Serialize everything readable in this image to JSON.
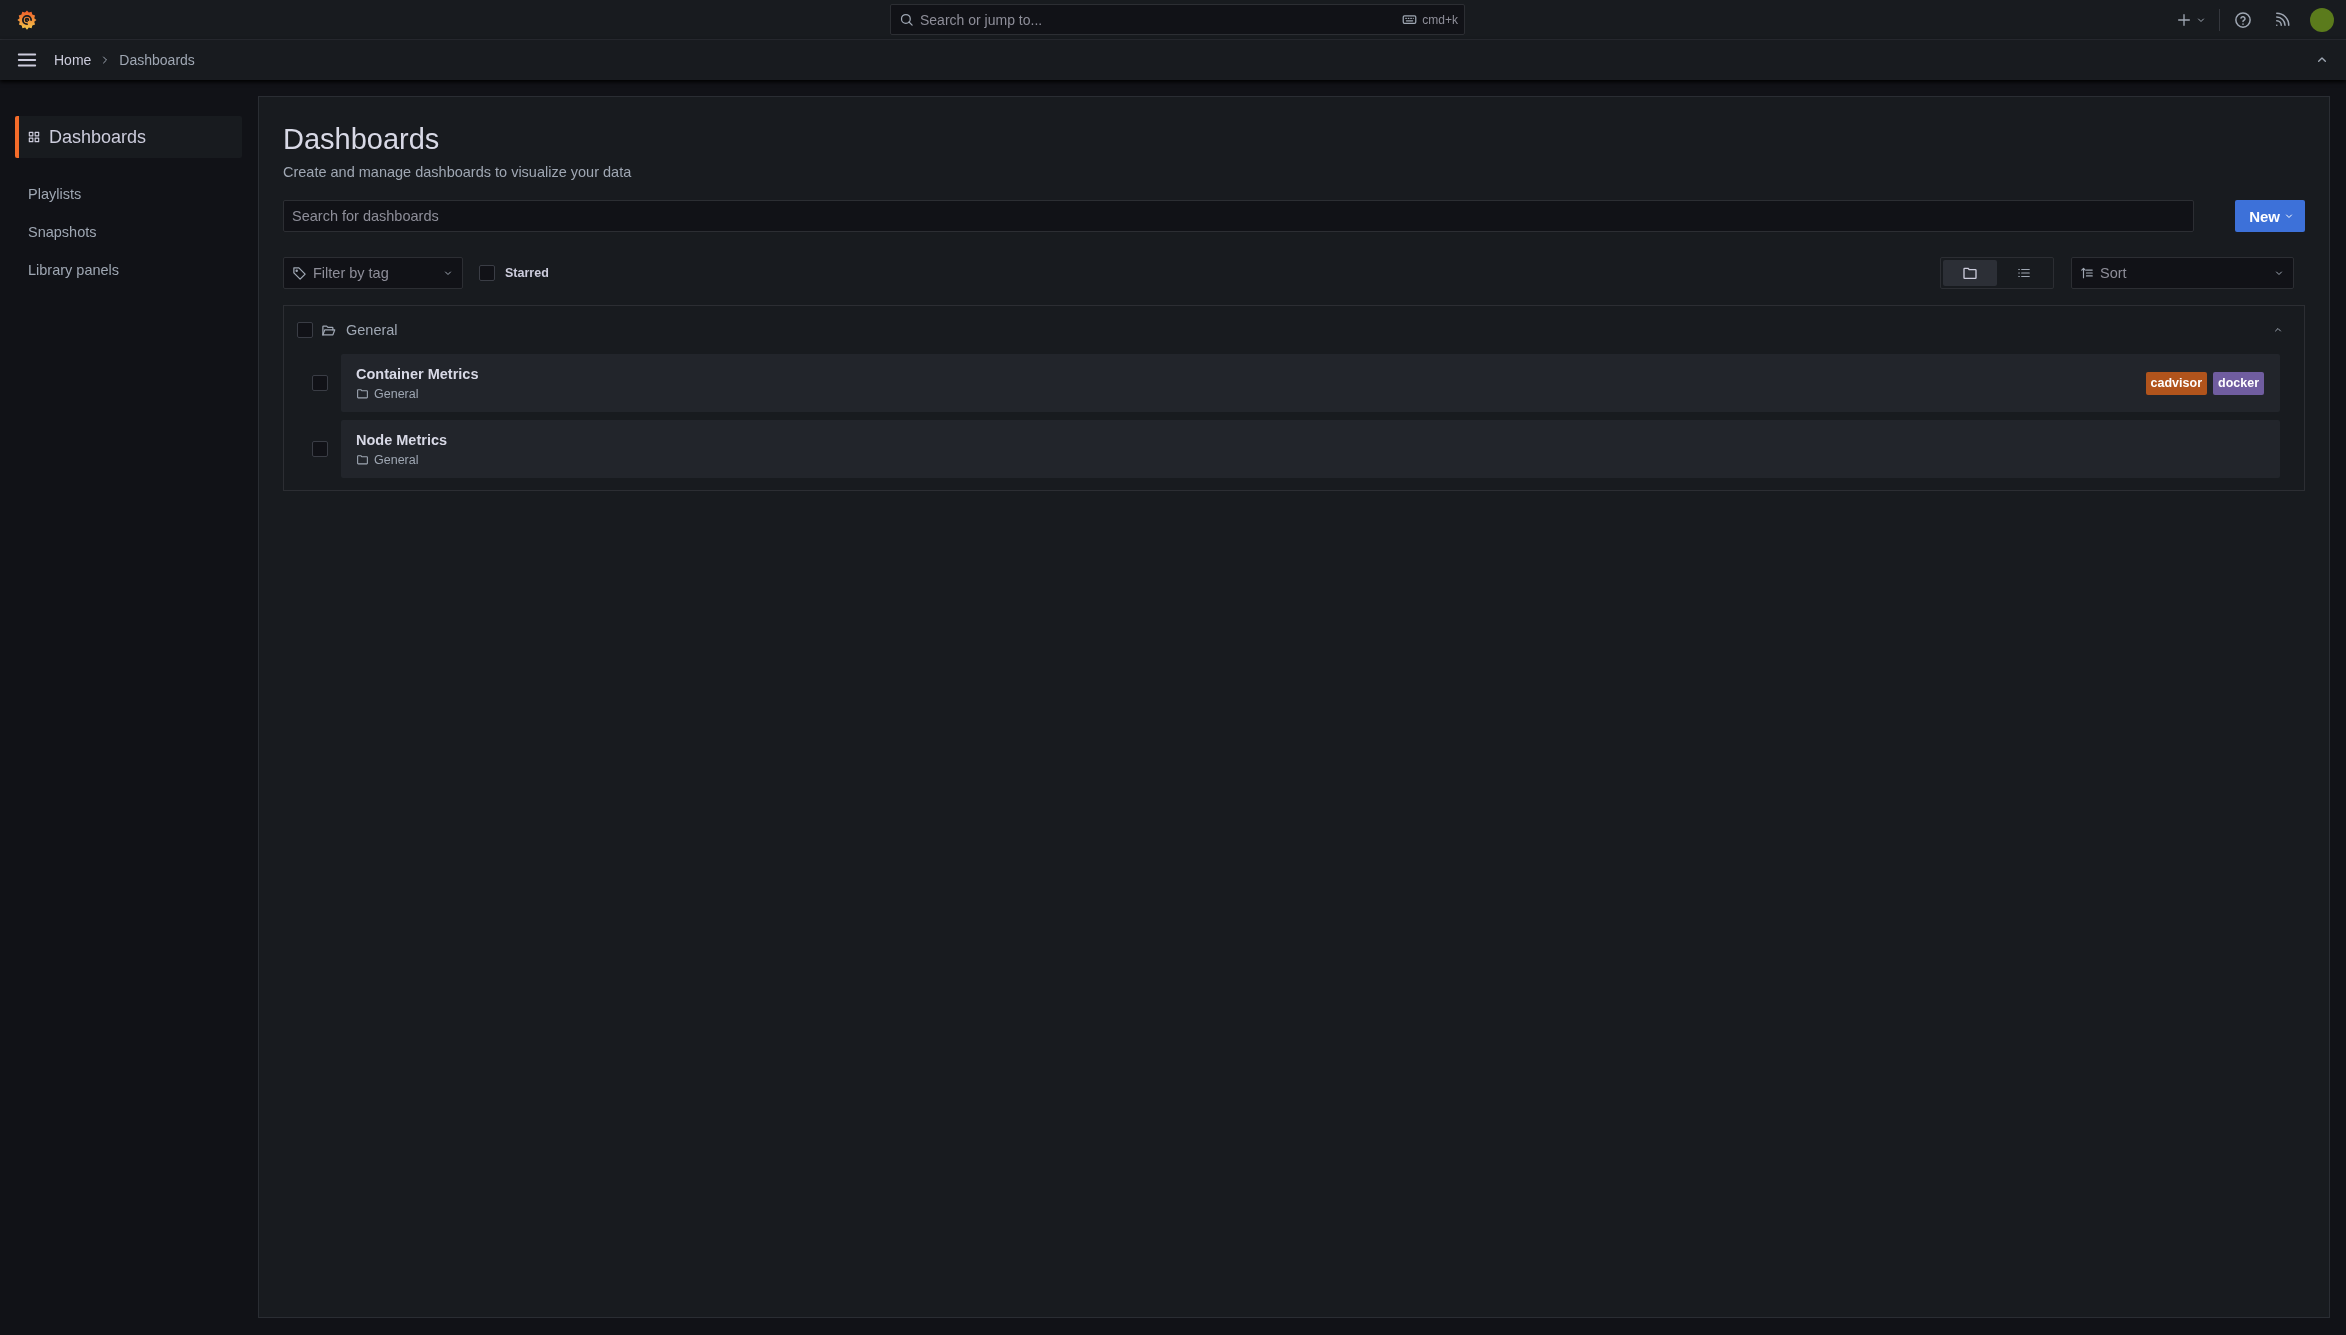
{
  "top_bar": {
    "search": {
      "placeholder": "Search or jump to...",
      "shortcut": "cmd+k"
    }
  },
  "breadcrumbs": [
    {
      "label": "Home",
      "selected": false
    },
    {
      "label": "Dashboards",
      "selected": true
    }
  ],
  "sidebar": {
    "items": [
      {
        "label": "Dashboards",
        "selected": true
      },
      {
        "label": "Playlists",
        "selected": false
      },
      {
        "label": "Snapshots",
        "selected": false
      },
      {
        "label": "Library panels",
        "selected": false
      }
    ]
  },
  "page": {
    "title": "Dashboards",
    "subtitle": "Create and manage dashboards to visualize your data",
    "search": {
      "placeholder": "Search for dashboards"
    },
    "new_button": "New",
    "filter": {
      "placeholder": "Filter by tag"
    },
    "starred": {
      "label": "Starred",
      "checked": false
    },
    "view_modes": [
      {
        "kind": "folder",
        "selected": true
      },
      {
        "kind": "list",
        "selected": false
      }
    ],
    "sort": {
      "placeholder": "Sort"
    },
    "folders": [
      {
        "name": "General",
        "expanded": true,
        "checked": false,
        "dashboards": [
          {
            "title": "Container Metrics",
            "folder": "General",
            "checked": false,
            "tags": [
              {
                "label": "cadvisor",
                "color": "#b1541c"
              },
              {
                "label": "docker",
                "color": "#705da0"
              }
            ]
          },
          {
            "title": "Node Metrics",
            "folder": "General",
            "checked": false
          }
        ]
      }
    ]
  }
}
